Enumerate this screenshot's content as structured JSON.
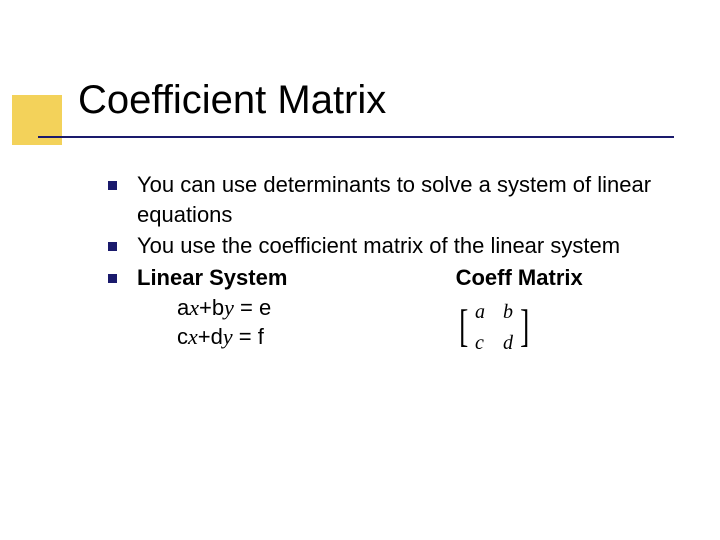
{
  "title": "Coefficient Matrix",
  "bullets": {
    "b1": "You can use determinants to solve a system of linear equations",
    "b2": "You use the coefficient matrix of the linear system",
    "b3_left": "Linear System",
    "b3_right": "Coeff Matrix"
  },
  "equations": {
    "line1_pre": "a",
    "line1_x": "x",
    "line1_mid": "+b",
    "line1_y": "y",
    "line1_post": " = e",
    "line2_pre": "c",
    "line2_x": "x",
    "line2_mid": "+d",
    "line2_y": "y",
    "line2_post": " = f"
  },
  "matrix": {
    "a": "a",
    "b": "b",
    "c": "c",
    "d": "d"
  }
}
